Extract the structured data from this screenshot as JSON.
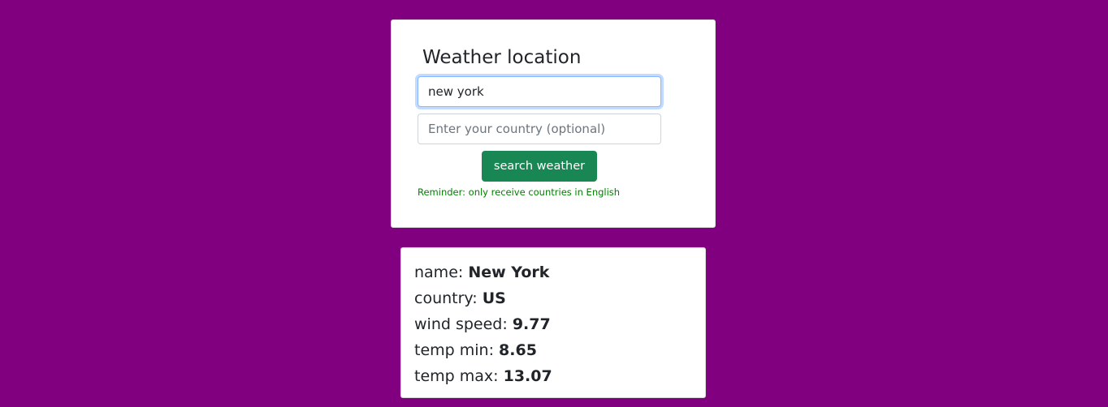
{
  "form": {
    "title": "Weather location",
    "city_input": {
      "value": "new york",
      "placeholder": ""
    },
    "country_input": {
      "value": "",
      "placeholder": "Enter your country (optional)"
    },
    "search_button": "search weather",
    "reminder": "Reminder: only receive countries in English"
  },
  "result": {
    "rows": [
      {
        "label": "name:",
        "value": "New York"
      },
      {
        "label": "country:",
        "value": "US"
      },
      {
        "label": "wind speed:",
        "value": "9.77"
      },
      {
        "label": "temp min:",
        "value": "8.65"
      },
      {
        "label": "temp max:",
        "value": "13.07"
      }
    ]
  },
  "colors": {
    "background": "#800080",
    "button": "#198754",
    "reminder_text": "#008000"
  }
}
